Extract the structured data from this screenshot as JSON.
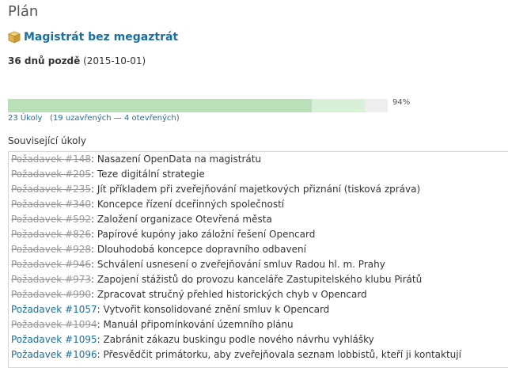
{
  "page": {
    "title": "Plán"
  },
  "version": {
    "name": "Magistrát bez megaztrát",
    "icon": "package-icon",
    "late_label": "36 dnů pozdě",
    "date": "(2015-10-01)"
  },
  "progress": {
    "closed_fraction": 0.8,
    "done_fraction": 0.94,
    "percent_label": "94%",
    "issue_count_label": "23 Úkoly",
    "open_paren": "(",
    "closed_label": "19 uzavřených",
    "separator": " — ",
    "open_label": "4 otevřených",
    "close_paren": ")"
  },
  "colors": {
    "link": "#1a6f9e",
    "closed_issue": "#999999",
    "bar_closed": "#bae0ba",
    "bar_done": "#d8f0d8"
  },
  "related": {
    "title": "Související úkoly",
    "issues": [
      {
        "ref": "Požadavek #148",
        "sep": ": ",
        "subject": "Nasazení OpenData na magistrátu",
        "status": "closed"
      },
      {
        "ref": "Požadavek #205",
        "sep": ": ",
        "subject": "Teze digitální strategie",
        "status": "closed"
      },
      {
        "ref": "Požadavek #235",
        "sep": ": ",
        "subject": "Jít příkladem při zveřejňování majetkových přiznání (tisková zpráva)",
        "status": "closed"
      },
      {
        "ref": "Požadavek #340",
        "sep": ": ",
        "subject": "Koncepce řízení dceřinných společností",
        "status": "closed"
      },
      {
        "ref": "Požadavek #592",
        "sep": ": ",
        "subject": "Založení organizace Otevřená města",
        "status": "closed"
      },
      {
        "ref": "Požadavek #826",
        "sep": ": ",
        "subject": "Papírové kupóny jako záložní řešení Opencard",
        "status": "closed"
      },
      {
        "ref": "Požadavek #928",
        "sep": ": ",
        "subject": "Dlouhodobá koncepce dopravního odbavení",
        "status": "closed"
      },
      {
        "ref": "Požadavek #946",
        "sep": ": ",
        "subject": "Schválení usnesení o zveřejňování smluv Radou hl. m. Prahy",
        "status": "closed"
      },
      {
        "ref": "Požadavek #973",
        "sep": ": ",
        "subject": "Zapojení stážistů do provozu kanceláře Zastupitelského klubu Pirátů",
        "status": "closed"
      },
      {
        "ref": "Požadavek #990",
        "sep": ": ",
        "subject": "Zpracovat stručný přehled historických chyb v Opencard",
        "status": "closed"
      },
      {
        "ref": "Požadavek #1057",
        "sep": ": ",
        "subject": "Vytvořit konsolidované znění smluv k Opencard",
        "status": "open"
      },
      {
        "ref": "Požadavek #1094",
        "sep": ": ",
        "subject": "Manuál připomínkování územního plánu",
        "status": "closed"
      },
      {
        "ref": "Požadavek #1095",
        "sep": ": ",
        "subject": "Zabránit zákazu buskingu podle nového návrhu vyhlášky",
        "status": "open"
      },
      {
        "ref": "Požadavek #1096",
        "sep": ": ",
        "subject": "Přesvědčit primátorku, aby zveřejňovala seznam lobbistů, kteří ji kontaktují",
        "status": "open"
      }
    ]
  }
}
